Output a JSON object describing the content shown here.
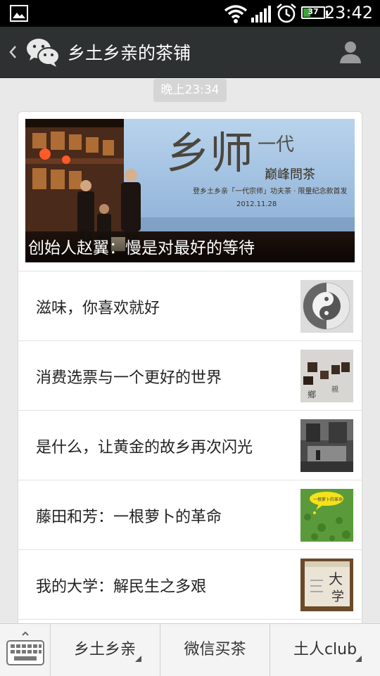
{
  "status_bar": {
    "battery": "37",
    "battery_level": 0.37,
    "time": "23:42",
    "icons": [
      "picture-icon",
      "wifi-icon",
      "signal-icon",
      "alarm-icon",
      "battery-icon"
    ]
  },
  "header": {
    "title": "乡土乡亲的茶铺",
    "icons": [
      "back-icon",
      "wechat-icon",
      "profile-icon"
    ]
  },
  "timestamp": "晚上23:34",
  "article": {
    "cover_caption": "创始人赵翼：慢是对最好的等待",
    "cover_banner_date": "2012.11.28",
    "items": [
      {
        "title": "滋味，你喜欢就好"
      },
      {
        "title": "消费选票与一个更好的世界"
      },
      {
        "title": "是什么，让黄金的故乡再次闪光"
      },
      {
        "title": "藤田和芳：一根萝卜的革命"
      },
      {
        "title": "我的大学：解民生之多艰"
      }
    ]
  },
  "bottom_menu": {
    "keyboard_icon": "keyboard-icon",
    "items": [
      {
        "label": "乡土乡亲"
      },
      {
        "label": "微信买茶"
      },
      {
        "label": "土人club"
      }
    ]
  },
  "colors": {
    "titlebar": "#2e3132",
    "background": "#e9e9e9",
    "battery_fill": "#3aa33a"
  }
}
